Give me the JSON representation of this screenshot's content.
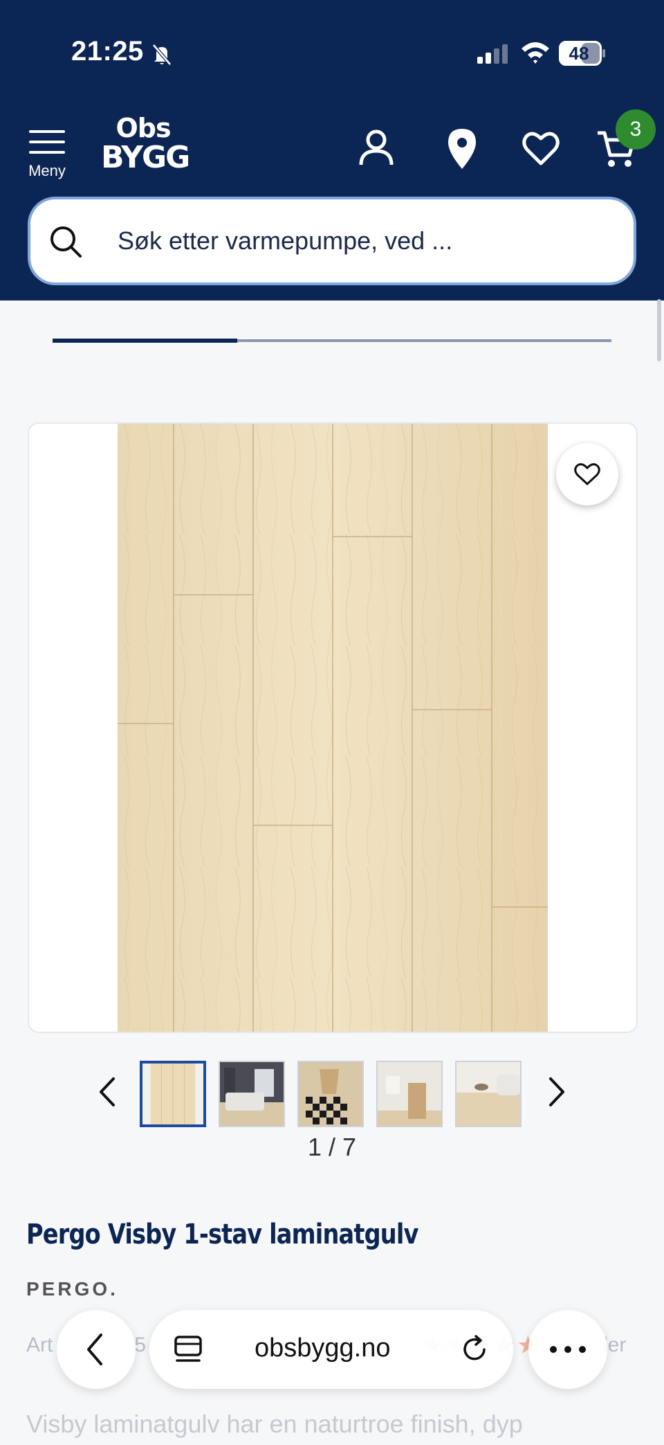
{
  "status_bar": {
    "time": "21:25",
    "battery": "48"
  },
  "header": {
    "menu_label": "Meny",
    "logo_line1": "Obs",
    "logo_line2": "BYGG",
    "cart_count": "3",
    "colors": {
      "background": "#0b2554",
      "badge": "#2e8b2e"
    }
  },
  "search": {
    "placeholder": "Søk etter varmepumpe, ved ..."
  },
  "gallery": {
    "progress_fraction": 0.33,
    "counter": "1 / 7",
    "thumbnails": [
      "laminate-floor",
      "bedroom",
      "chair-checkered-rug",
      "hallway-cabinet",
      "living-room-sofa"
    ]
  },
  "product": {
    "title": "Pergo Visby 1-stav laminatgulv",
    "brand": "PERGO.",
    "article_prefix": "Art",
    "article_partial": "5",
    "reviews_partial": "ler",
    "description_partial": "Visby laminatgulv har en naturtroe finish, dyp"
  },
  "browser": {
    "url": "obsbygg.no"
  },
  "icons": [
    "bell-slash-icon",
    "signal-icon",
    "wifi-icon",
    "battery-icon",
    "menu-icon",
    "account-icon",
    "location-pin-icon",
    "heart-icon",
    "cart-icon",
    "search-icon",
    "chevron-left-icon",
    "chevron-right-icon",
    "tabs-icon",
    "reload-icon",
    "more-icon"
  ]
}
